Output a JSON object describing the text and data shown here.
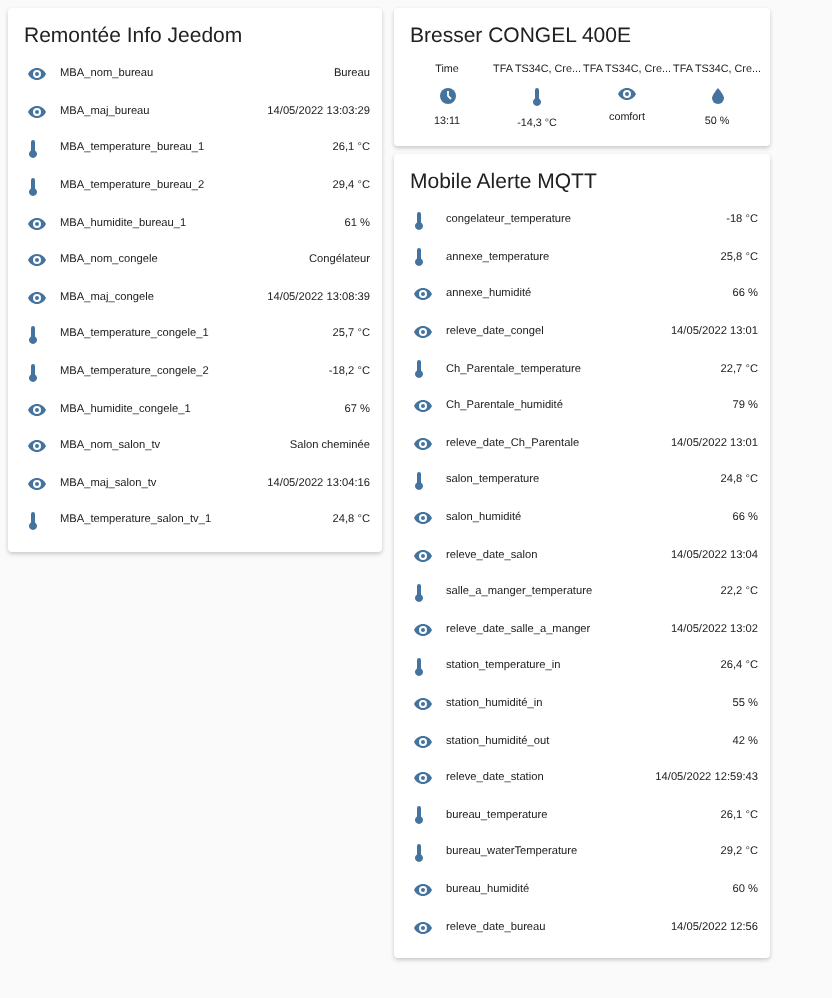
{
  "cards": [
    {
      "title": "Remontée Info Jeedom",
      "kind": "entities",
      "rows": [
        {
          "kind": "eye",
          "name": "MBA_nom_bureau",
          "value": "Bureau"
        },
        {
          "kind": "eye",
          "name": "MBA_maj_bureau",
          "value": "14/05/2022 13:03:29"
        },
        {
          "kind": "thermometer",
          "name": "MBA_temperature_bureau_1",
          "value": "26,1 °C"
        },
        {
          "kind": "thermometer",
          "name": "MBA_temperature_bureau_2",
          "value": "29,4 °C"
        },
        {
          "kind": "eye",
          "name": "MBA_humidite_bureau_1",
          "value": "61 %"
        },
        {
          "kind": "eye",
          "name": "MBA_nom_congele",
          "value": "Congélateur"
        },
        {
          "kind": "eye",
          "name": "MBA_maj_congele",
          "value": "14/05/2022 13:08:39"
        },
        {
          "kind": "thermometer",
          "name": "MBA_temperature_congele_1",
          "value": "25,7 °C"
        },
        {
          "kind": "thermometer",
          "name": "MBA_temperature_congele_2",
          "value": "-18,2 °C"
        },
        {
          "kind": "eye",
          "name": "MBA_humidite_congele_1",
          "value": "67 %"
        },
        {
          "kind": "eye",
          "name": "MBA_nom_salon_tv",
          "value": "Salon cheminée"
        },
        {
          "kind": "eye",
          "name": "MBA_maj_salon_tv",
          "value": "14/05/2022 13:04:16"
        },
        {
          "kind": "thermometer",
          "name": "MBA_temperature_salon_tv_1",
          "value": "24,8 °C"
        }
      ]
    },
    {
      "title": "Bresser CONGEL 400E",
      "kind": "glance",
      "items": [
        {
          "kind": "clock",
          "name": "Time",
          "value": "13:11"
        },
        {
          "kind": "thermometer",
          "name": "TFA TS34C, Cre...",
          "value": "-14,3 °C"
        },
        {
          "kind": "eye",
          "name": "TFA TS34C, Cre...",
          "value": "comfort"
        },
        {
          "kind": "drop",
          "name": "TFA TS34C, Cre...",
          "value": "50 %"
        }
      ]
    },
    {
      "title": "Mobile Alerte MQTT",
      "kind": "entities",
      "rows": [
        {
          "kind": "thermometer",
          "name": "congelateur_temperature",
          "value": "-18 °C"
        },
        {
          "kind": "thermometer",
          "name": "annexe_temperature",
          "value": "25,8 °C"
        },
        {
          "kind": "eye",
          "name": "annexe_humidité",
          "value": "66 %"
        },
        {
          "kind": "eye",
          "name": "releve_date_congel",
          "value": "14/05/2022 13:01"
        },
        {
          "kind": "thermometer",
          "name": "Ch_Parentale_temperature",
          "value": "22,7 °C"
        },
        {
          "kind": "eye",
          "name": "Ch_Parentale_humidité",
          "value": "79 %"
        },
        {
          "kind": "eye",
          "name": "releve_date_Ch_Parentale",
          "value": "14/05/2022 13:01"
        },
        {
          "kind": "thermometer",
          "name": "salon_temperature",
          "value": "24,8 °C"
        },
        {
          "kind": "eye",
          "name": "salon_humidité",
          "value": "66 %"
        },
        {
          "kind": "eye",
          "name": "releve_date_salon",
          "value": "14/05/2022 13:04"
        },
        {
          "kind": "thermometer",
          "name": "salle_a_manger_temperature",
          "value": "22,2 °C"
        },
        {
          "kind": "eye",
          "name": "releve_date_salle_a_manger",
          "value": "14/05/2022 13:02"
        },
        {
          "kind": "thermometer",
          "name": "station_temperature_in",
          "value": "26,4 °C"
        },
        {
          "kind": "eye",
          "name": "station_humidité_in",
          "value": "55 %"
        },
        {
          "kind": "eye",
          "name": "station_humidité_out",
          "value": "42 %"
        },
        {
          "kind": "eye",
          "name": "releve_date_station",
          "value": "14/05/2022 12:59:43"
        },
        {
          "kind": "thermometer",
          "name": "bureau_temperature",
          "value": "26,1 °C"
        },
        {
          "kind": "thermometer",
          "name": "bureau_waterTemperature",
          "value": "29,2 °C"
        },
        {
          "kind": "eye",
          "name": "bureau_humidité",
          "value": "60 %"
        },
        {
          "kind": "eye",
          "name": "releve_date_bureau",
          "value": "14/05/2022 12:56"
        }
      ]
    }
  ]
}
